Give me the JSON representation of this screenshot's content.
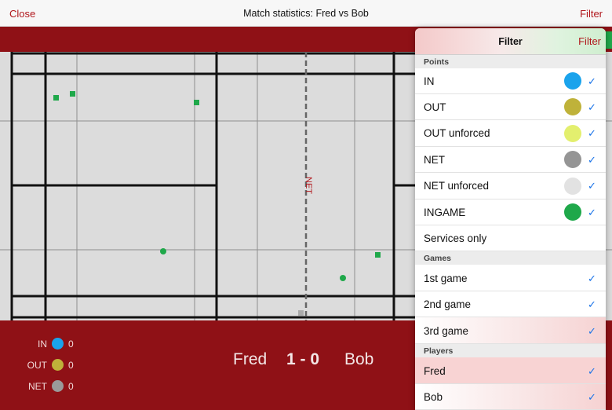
{
  "nav": {
    "close_label": "Close",
    "title": "Match statistics: Fred vs Bob",
    "filter_label": "Filter"
  },
  "court": {
    "net_label": "NET",
    "points": [
      {
        "shape": "square",
        "color": "#1fa84a"
      },
      {
        "shape": "square",
        "color": "#1fa84a"
      },
      {
        "shape": "square",
        "color": "#1fa84a"
      },
      {
        "shape": "circle",
        "color": "#1fa84a"
      },
      {
        "shape": "square",
        "color": "#1fa84a"
      },
      {
        "shape": "circle",
        "color": "#1fa84a"
      },
      {
        "shape": "square",
        "color": "#aaaaaa"
      }
    ]
  },
  "legend": [
    {
      "label": "IN",
      "color": "#1aa3ec",
      "count": "0"
    },
    {
      "label": "OUT",
      "color": "#bfb23a",
      "count": "0"
    },
    {
      "label": "NET",
      "color": "#9a9a9a",
      "count": "0"
    }
  ],
  "score": {
    "player1": "Fred",
    "result": "1 - 0",
    "player2": "Bob"
  },
  "filter_panel": {
    "title": "Filter",
    "action_label": "Filter",
    "sections": {
      "points": "Points",
      "games": "Games",
      "players": "Players"
    },
    "points": [
      {
        "label": "IN",
        "color": "#1aa3ec",
        "checked": true
      },
      {
        "label": "OUT",
        "color": "#bfb23a",
        "checked": true
      },
      {
        "label": "OUT unforced",
        "color": "#e3ef6e",
        "checked": true
      },
      {
        "label": "NET",
        "color": "#959595",
        "checked": true
      },
      {
        "label": "NET unforced",
        "color": "#e2e2e2",
        "checked": true
      },
      {
        "label": "INGAME",
        "color": "#1fa84a",
        "checked": true
      },
      {
        "label": "Services only",
        "color": "",
        "checked": false
      }
    ],
    "games": [
      {
        "label": "1st game",
        "checked": true
      },
      {
        "label": "2nd game",
        "checked": true
      },
      {
        "label": "3rd game",
        "checked": true
      }
    ],
    "players": [
      {
        "label": "Fred",
        "checked": true
      },
      {
        "label": "Bob",
        "checked": true
      }
    ],
    "check_glyph": "✓"
  }
}
